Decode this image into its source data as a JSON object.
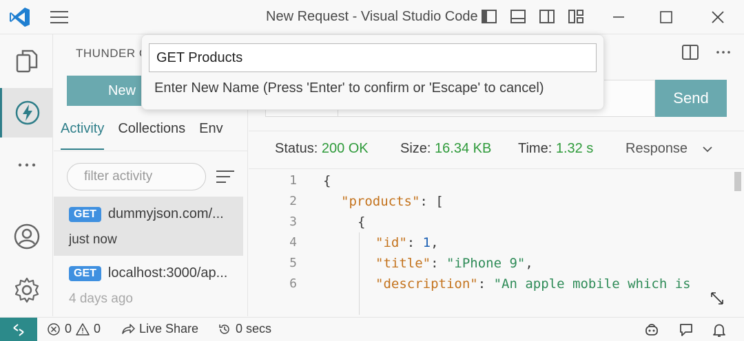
{
  "window": {
    "title": "New Request - Visual Studio Code"
  },
  "sidebar": {
    "title": "THUNDER C",
    "new_button": "New",
    "tabs": [
      {
        "label": "Activity",
        "active": true
      },
      {
        "label": "Collections",
        "active": false
      },
      {
        "label": "Env",
        "active": false
      }
    ],
    "filter_placeholder": "filter activity",
    "requests": [
      {
        "method": "GET",
        "url": "dummyjson.com/...",
        "time": "just now",
        "selected": true
      },
      {
        "method": "GET",
        "url": "localhost:3000/ap...",
        "time": "4 days ago",
        "selected": false
      }
    ]
  },
  "quick_input": {
    "value": "GET Products",
    "hint": "Enter New Name (Press 'Enter' to confirm or 'Escape' to cancel)"
  },
  "request": {
    "send_label": "Send"
  },
  "response": {
    "status_label": "Status:",
    "status_value": "200 OK",
    "size_label": "Size:",
    "size_value": "16.34 KB",
    "time_label": "Time:",
    "time_value": "1.32 s",
    "view_label": "Response",
    "lines": [
      "1",
      "2",
      "3",
      "4",
      "5",
      "6"
    ],
    "code": {
      "l1": "{",
      "l2_key": "\"products\"",
      "l2_rest": ": [",
      "l3": "{",
      "l4_key": "\"id\"",
      "l4_colon": ": ",
      "l4_val": "1",
      "l4_end": ",",
      "l5_key": "\"title\"",
      "l5_colon": ": ",
      "l5_val": "\"iPhone 9\"",
      "l5_end": ",",
      "l6_key": "\"description\"",
      "l6_colon": ": ",
      "l6_val": "\"An apple mobile which is"
    }
  },
  "statusbar": {
    "errors": "0",
    "warnings": "0",
    "live_share": "Live Share",
    "timer": "0 secs"
  },
  "colors": {
    "accent": "#2e7e89",
    "button": "#6aa9af",
    "success": "#2e9a3a",
    "badge": "#3f90e0",
    "remote": "#2c8a8a"
  }
}
